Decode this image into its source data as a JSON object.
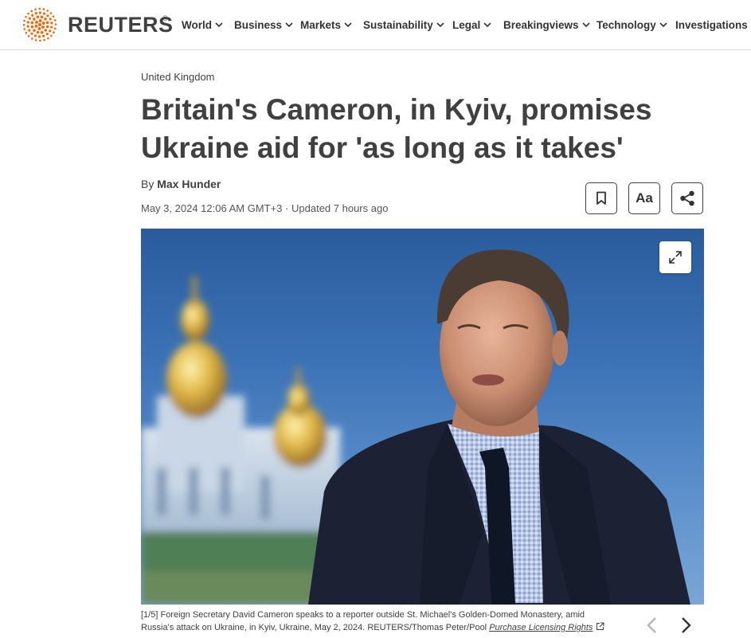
{
  "brand": {
    "wordmark": "REUTERS",
    "registered": "®",
    "accent_color": "#fa6400",
    "logo_icon": "reuters-dot-logo"
  },
  "nav": {
    "items": [
      {
        "label": "World",
        "has_dropdown": true
      },
      {
        "label": "Business",
        "has_dropdown": true
      },
      {
        "label": "Markets",
        "has_dropdown": true
      },
      {
        "label": "Sustainability",
        "has_dropdown": true
      },
      {
        "label": "Legal",
        "has_dropdown": true
      },
      {
        "label": "Breakingviews",
        "has_dropdown": true
      },
      {
        "label": "Technology",
        "has_dropdown": true
      },
      {
        "label": "Investigations",
        "has_dropdown": false
      }
    ]
  },
  "article": {
    "section": "United Kingdom",
    "headline": "Britain's Cameron, in Kyiv, promises Ukraine aid for 'as long as it takes'",
    "byline_prefix": "By",
    "author": "Max Hunder",
    "published": "May 3, 2024 12:06 AM GMT+3",
    "separator": "·",
    "updated": "Updated 7 hours ago",
    "tools": {
      "bookmark_icon": "bookmark-icon",
      "text_size_label": "Aa",
      "share_icon": "share-icon"
    }
  },
  "gallery": {
    "counter": "[1/5]",
    "caption": "Foreign Secretary David Cameron speaks to a reporter outside St. Michael's Golden-Domed Monastery, amid Russia's attack on Ukraine, in Kyiv, Ukraine, May 2, 2024. REUTERS/Thomas Peter/Pool",
    "licensing_link": "Purchase Licensing Rights",
    "expand_icon": "expand-icon",
    "prev_icon": "chevron-left-icon",
    "next_icon": "chevron-right-icon"
  }
}
